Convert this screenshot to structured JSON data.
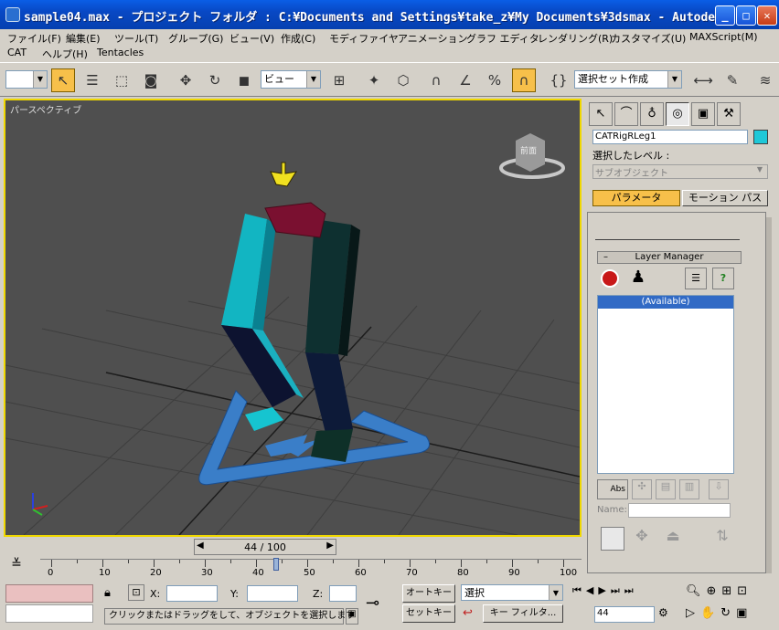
{
  "window": {
    "title": "sample04.max  - プロジェクト フォルダ : C:¥Documents and Settings¥take_z¥My Documents¥3dsmax  - Autode..."
  },
  "menu": {
    "row1": [
      "ファイル(F)",
      "編集(E)",
      "ツール(T)",
      "グループ(G)",
      "ビュー(V)",
      "作成(C)",
      "モディファイヤ",
      "アニメーション",
      "グラフ エディタ",
      "レンダリング(R)",
      "カスタマイズ(U)",
      "MAXScript(M)"
    ],
    "row2": [
      "CAT",
      "ヘルプ(H)",
      "Tentacles"
    ]
  },
  "toolbar": {
    "selection_filter": "",
    "ref_coord": "ビュー",
    "selection_set": "選択セット作成"
  },
  "viewport": {
    "label": "パースペクティブ",
    "view_cube_label": "前面"
  },
  "command_panel": {
    "object_name": "CATRigRLeg1",
    "object_color": "#1ec8d8",
    "level_label": "選択したレベル :",
    "subobject_label": "サブオブジェクト",
    "tab_params": "パラメータ",
    "tab_motion": "モーション パス",
    "layer_manager_title": "Layer Manager",
    "layer_minus": "–",
    "layer_list": [
      "(Available)"
    ],
    "abs_label": "Abs",
    "name_label": "Name:"
  },
  "timeline": {
    "frame_display": "44 / 100",
    "current_frame": 44,
    "total_frames": 100,
    "ticks": [
      0,
      10,
      20,
      30,
      40,
      50,
      60,
      70,
      80,
      90,
      100
    ]
  },
  "status": {
    "x_label": "X:",
    "y_label": "Y:",
    "z_label": "Z:",
    "auto_key": "オートキー",
    "set_key": "セットキー",
    "key_mode": "選択",
    "key_filter": "キー フィルタ...",
    "prompt": "クリックまたはドラッグをして、オブジェクトを選択します",
    "frame_field": "44"
  }
}
